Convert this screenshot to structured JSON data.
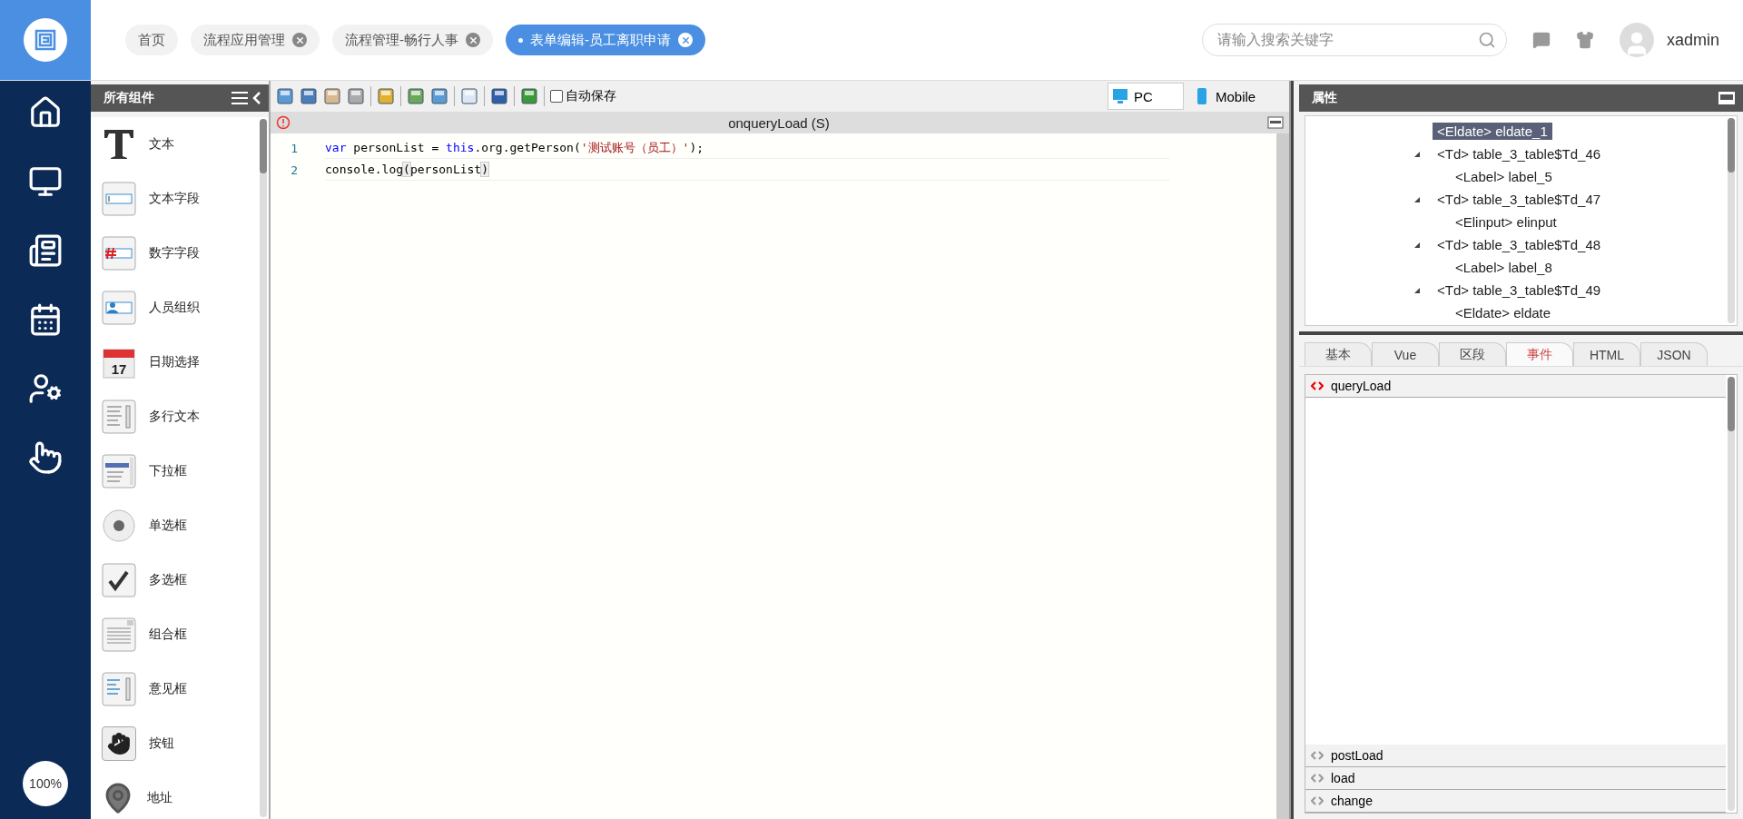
{
  "nav": {
    "items": [
      {
        "kind": "home"
      },
      {
        "kind": "monitor"
      },
      {
        "kind": "news"
      },
      {
        "kind": "calendar"
      },
      {
        "kind": "user-gear"
      },
      {
        "kind": "pointer"
      }
    ],
    "zoom": "100%"
  },
  "tabs": [
    {
      "label": "首页",
      "closable": false,
      "selected": false
    },
    {
      "label": "流程应用管理",
      "closable": true,
      "selected": false
    },
    {
      "label": "流程管理-畅行人事",
      "closable": true,
      "selected": false
    },
    {
      "label": "表单编辑-员工离职申请",
      "closable": true,
      "selected": true
    }
  ],
  "search": {
    "placeholder": "请输入搜索关键字"
  },
  "user": {
    "name": "xadmin"
  },
  "components": {
    "title": "所有组件",
    "items": [
      {
        "label": "文本",
        "kind": "text"
      },
      {
        "label": "文本字段",
        "kind": "textfield"
      },
      {
        "label": "数字字段",
        "kind": "number"
      },
      {
        "label": "人员组织",
        "kind": "person"
      },
      {
        "label": "日期选择",
        "kind": "date",
        "day": "17"
      },
      {
        "label": "多行文本",
        "kind": "textarea"
      },
      {
        "label": "下拉框",
        "kind": "select"
      },
      {
        "label": "单选框",
        "kind": "radio"
      },
      {
        "label": "多选框",
        "kind": "checkbox"
      },
      {
        "label": "组合框",
        "kind": "combo"
      },
      {
        "label": "意见框",
        "kind": "opinion"
      },
      {
        "label": "按钮",
        "kind": "button"
      },
      {
        "label": "地址",
        "kind": "address"
      }
    ]
  },
  "toolbar": {
    "autosave": {
      "label": "自动保存",
      "checked": false
    },
    "views": [
      {
        "label": "PC",
        "selected": true,
        "kind": "pc"
      },
      {
        "label": "Mobile",
        "selected": false,
        "kind": "mobile"
      }
    ]
  },
  "editor": {
    "title": "onqueryLoad (S)",
    "lines": [
      {
        "number": "1",
        "tokens": [
          {
            "kind": "keyword",
            "text": "var"
          },
          {
            "kind": "plain",
            "text": " personList = "
          },
          {
            "kind": "keyword",
            "text": "this"
          },
          {
            "kind": "plain",
            "text": ".org.getPerson("
          },
          {
            "kind": "string",
            "text": "'测试账号（员工）'"
          },
          {
            "kind": "plain",
            "text": ");"
          }
        ]
      },
      {
        "number": "2",
        "tokens": [
          {
            "kind": "plain",
            "text": "console.log"
          },
          {
            "kind": "bracket",
            "text": "("
          },
          {
            "kind": "plain",
            "text": "personList"
          },
          {
            "kind": "bracket",
            "text": ")"
          }
        ]
      }
    ]
  },
  "properties": {
    "title": "属性",
    "tree": [
      {
        "label": "<Eldate> eldate_1",
        "selected": true
      },
      {
        "label": "<Td> table_3_table$Td_46",
        "selected": false,
        "expanded": true,
        "children": [
          {
            "label": "<Label> label_5",
            "selected": false
          }
        ]
      },
      {
        "label": "<Td> table_3_table$Td_47",
        "selected": false,
        "expanded": true,
        "children": [
          {
            "label": "<Elinput> elinput",
            "selected": false
          }
        ]
      },
      {
        "label": "<Td> table_3_table$Td_48",
        "selected": false,
        "expanded": true,
        "children": [
          {
            "label": "<Label> label_8",
            "selected": false
          }
        ]
      },
      {
        "label": "<Td> table_3_table$Td_49",
        "selected": false,
        "expanded": true,
        "children": [
          {
            "label": "<Eldate> eldate",
            "selected": false
          }
        ]
      }
    ],
    "tabs": [
      {
        "label": "基本",
        "selected": false
      },
      {
        "label": "Vue",
        "selected": false
      },
      {
        "label": "区段",
        "selected": false
      },
      {
        "label": "事件",
        "selected": true
      },
      {
        "label": "HTML",
        "selected": false
      },
      {
        "label": "JSON",
        "selected": false
      }
    ],
    "events": [
      {
        "label": "queryLoad",
        "expanded": true
      },
      {
        "label": "postLoad",
        "expanded": false
      },
      {
        "label": "load",
        "expanded": false
      },
      {
        "label": "change",
        "expanded": false
      }
    ]
  }
}
